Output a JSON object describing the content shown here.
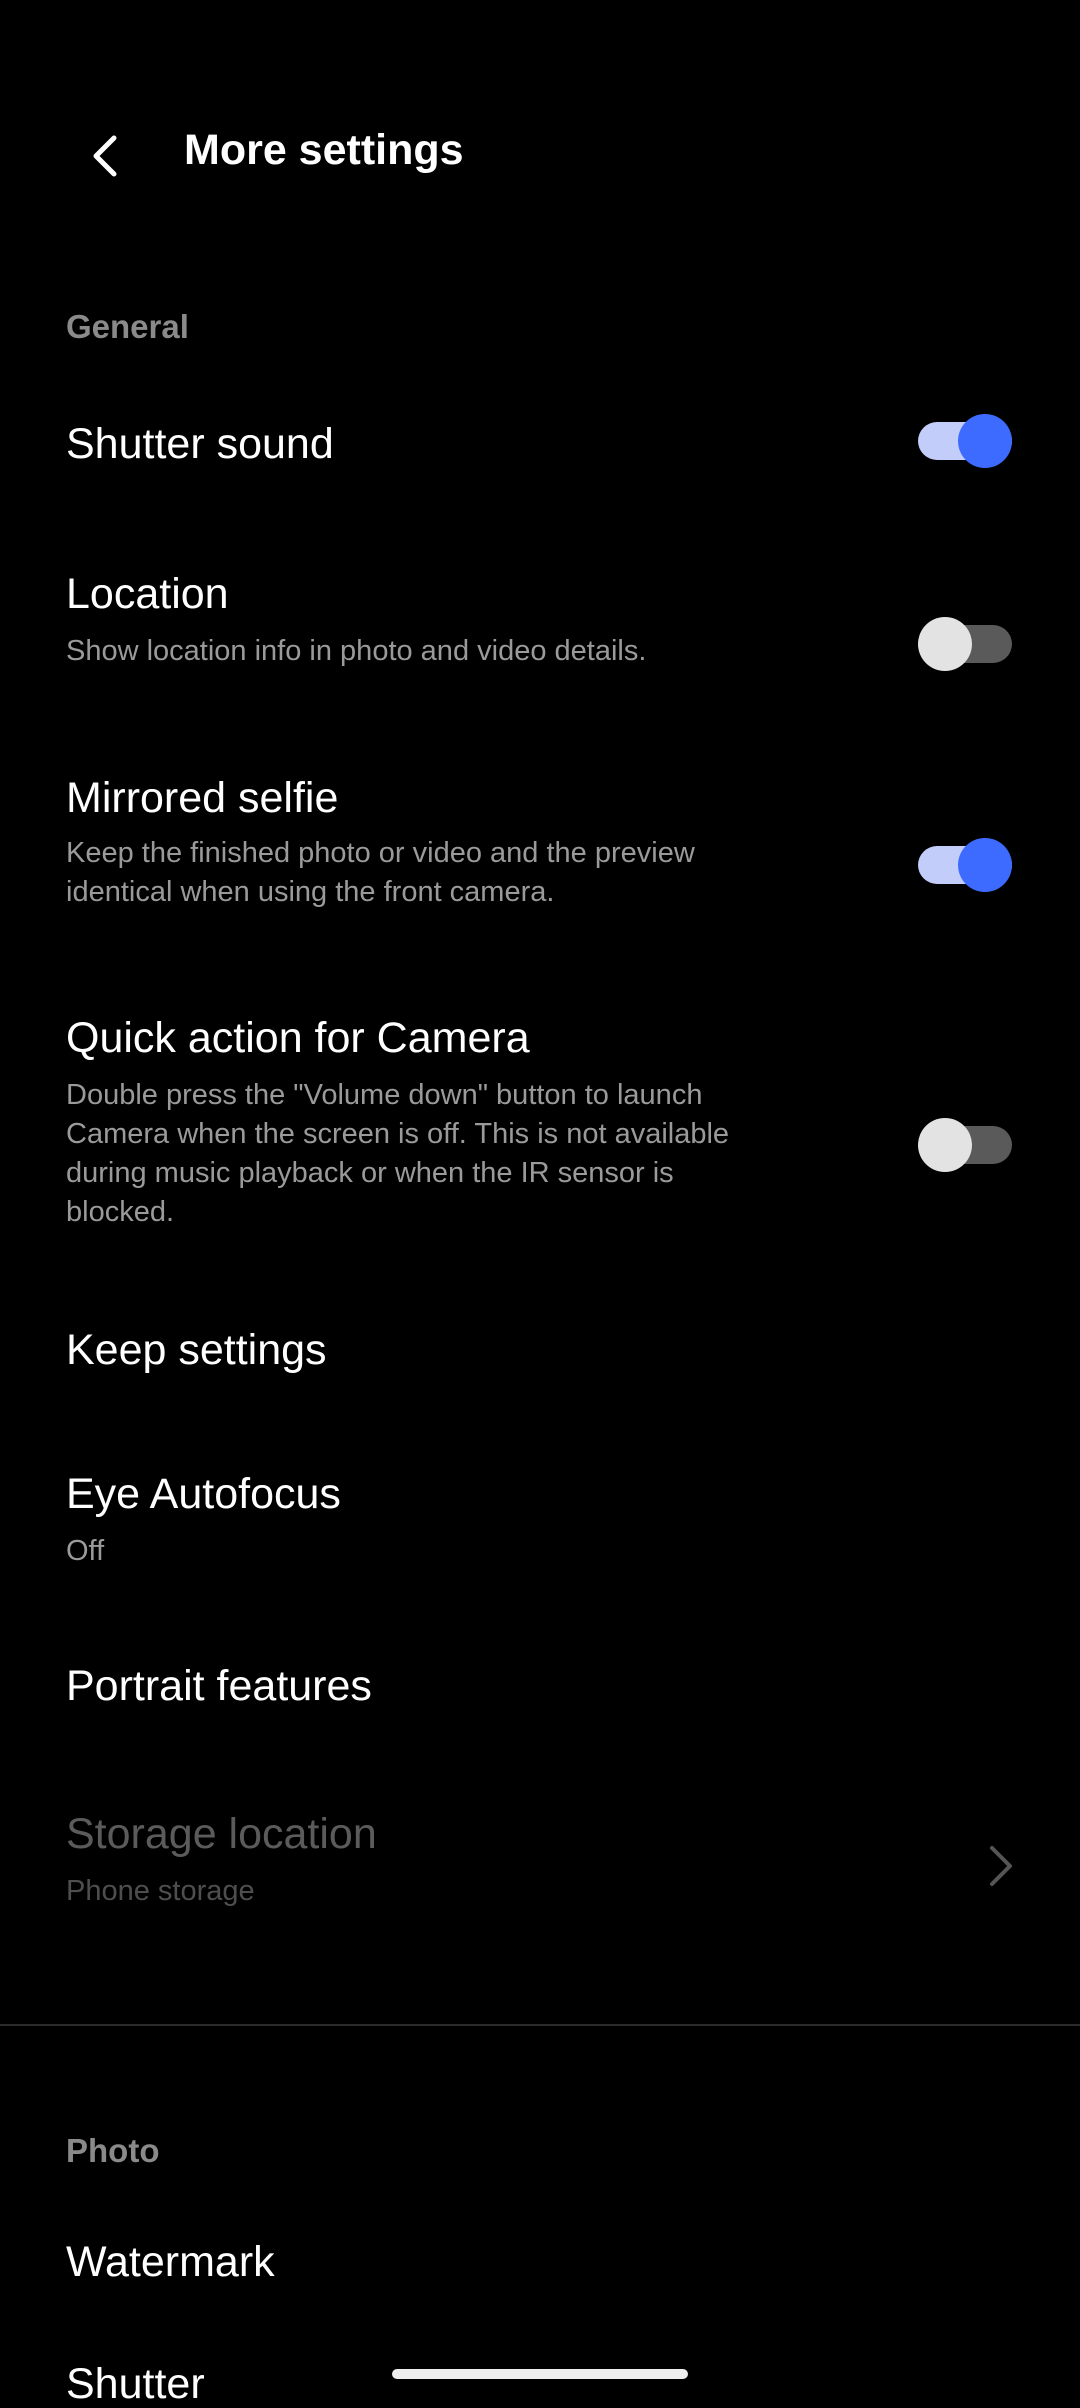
{
  "header": {
    "title": "More settings",
    "back_icon": "chevron-left-icon"
  },
  "sections": {
    "general": "General",
    "photo": "Photo"
  },
  "settings": {
    "shutter_sound": {
      "title": "Shutter sound",
      "enabled": true
    },
    "location": {
      "title": "Location",
      "subtitle": "Show location info in photo and video details.",
      "enabled": false
    },
    "mirrored_selfie": {
      "title": "Mirrored selfie",
      "subtitle": "Keep the finished photo or video and the preview identical when using the front camera.",
      "enabled": true
    },
    "quick_action": {
      "title": "Quick action for Camera",
      "subtitle": "Double press the \"Volume down\" button to launch Camera when the screen is off. This is not available during music playback or when the IR sensor is blocked.",
      "enabled": false
    },
    "keep_settings": {
      "title": "Keep settings"
    },
    "eye_autofocus": {
      "title": "Eye Autofocus",
      "value": "Off"
    },
    "portrait_features": {
      "title": "Portrait features"
    },
    "storage_location": {
      "title": "Storage location",
      "value": "Phone storage",
      "icon": "chevron-right-icon"
    },
    "watermark": {
      "title": "Watermark"
    },
    "shutter": {
      "title": "Shutter"
    }
  },
  "colors": {
    "accent": "#3d6bff",
    "accent_track": "#c2cdfa",
    "background": "#000000"
  }
}
